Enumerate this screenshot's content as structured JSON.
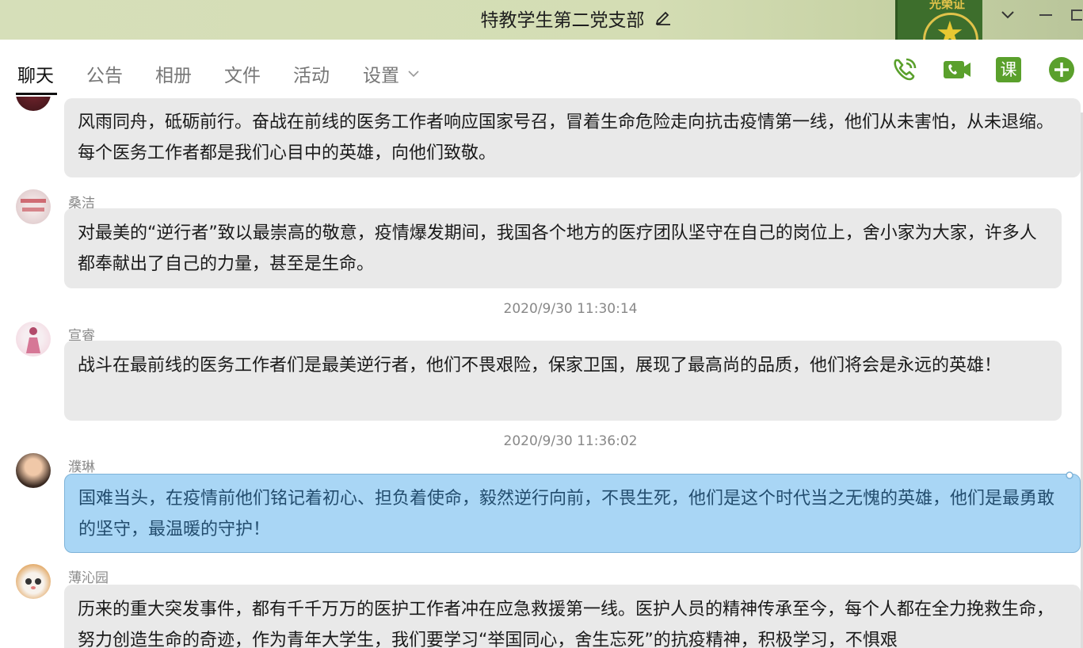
{
  "window": {
    "title": "特教学生第二党支部",
    "skin_text": "光榮证"
  },
  "tabs": [
    {
      "label": "聊天",
      "active": true
    },
    {
      "label": "公告",
      "active": false
    },
    {
      "label": "相册",
      "active": false
    },
    {
      "label": "文件",
      "active": false
    },
    {
      "label": "活动",
      "active": false
    },
    {
      "label": "设置",
      "active": false
    }
  ],
  "toolbar": {
    "course_label": "课",
    "accent_color": "#5aa02c",
    "icons": [
      "phone-icon",
      "video-call-icon",
      "course-icon",
      "add-icon"
    ]
  },
  "messages": [
    {
      "sender": "",
      "text": "风雨同舟，砥砺前行。奋战在前线的医务工作者响应国家号召，冒着生命危险走向抗击疫情第一线，他们从未害怕，从未退缩。每个医务工作者都是我们心目中的英雄，向他们致敬。",
      "mine": false
    },
    {
      "sender": "桑洁",
      "text": "对最美的“逆行者”致以最崇高的敬意，疫情爆发期间，我国各个地方的医疗团队坚守在自己的岗位上，舍小家为大家，许多人都奉献出了自己的力量，甚至是生命。",
      "mine": false
    },
    {
      "timestamp": "2020/9/30 11:30:14"
    },
    {
      "sender": "宣睿",
      "text": "战斗在最前线的医务工作者们是最美逆行者，他们不畏艰险，保家卫国，展现了最高尚的品质，他们将会是永远的英雄！",
      "mine": false
    },
    {
      "timestamp": "2020/9/30 11:36:02"
    },
    {
      "sender": "濮琳",
      "text": "国难当头，在疫情前他们铭记着初心、担负着使命，毅然逆行向前，不畏生死，他们是这个时代当之无愧的英雄，他们是最勇敢的坚守，最温暖的守护！",
      "mine": true
    },
    {
      "sender": "薄沁园",
      "text": "历来的重大突发事件，都有千千万万的医护工作者冲在应急救援第一线。医护人员的精神传承至今，每个人都在全力挽救生命，努力创造生命的奇迹，作为青年大学生，我们要学习“举国同心，舍生忘死”的抗疫精神，积极学习，不惧艰",
      "mine": false
    }
  ]
}
